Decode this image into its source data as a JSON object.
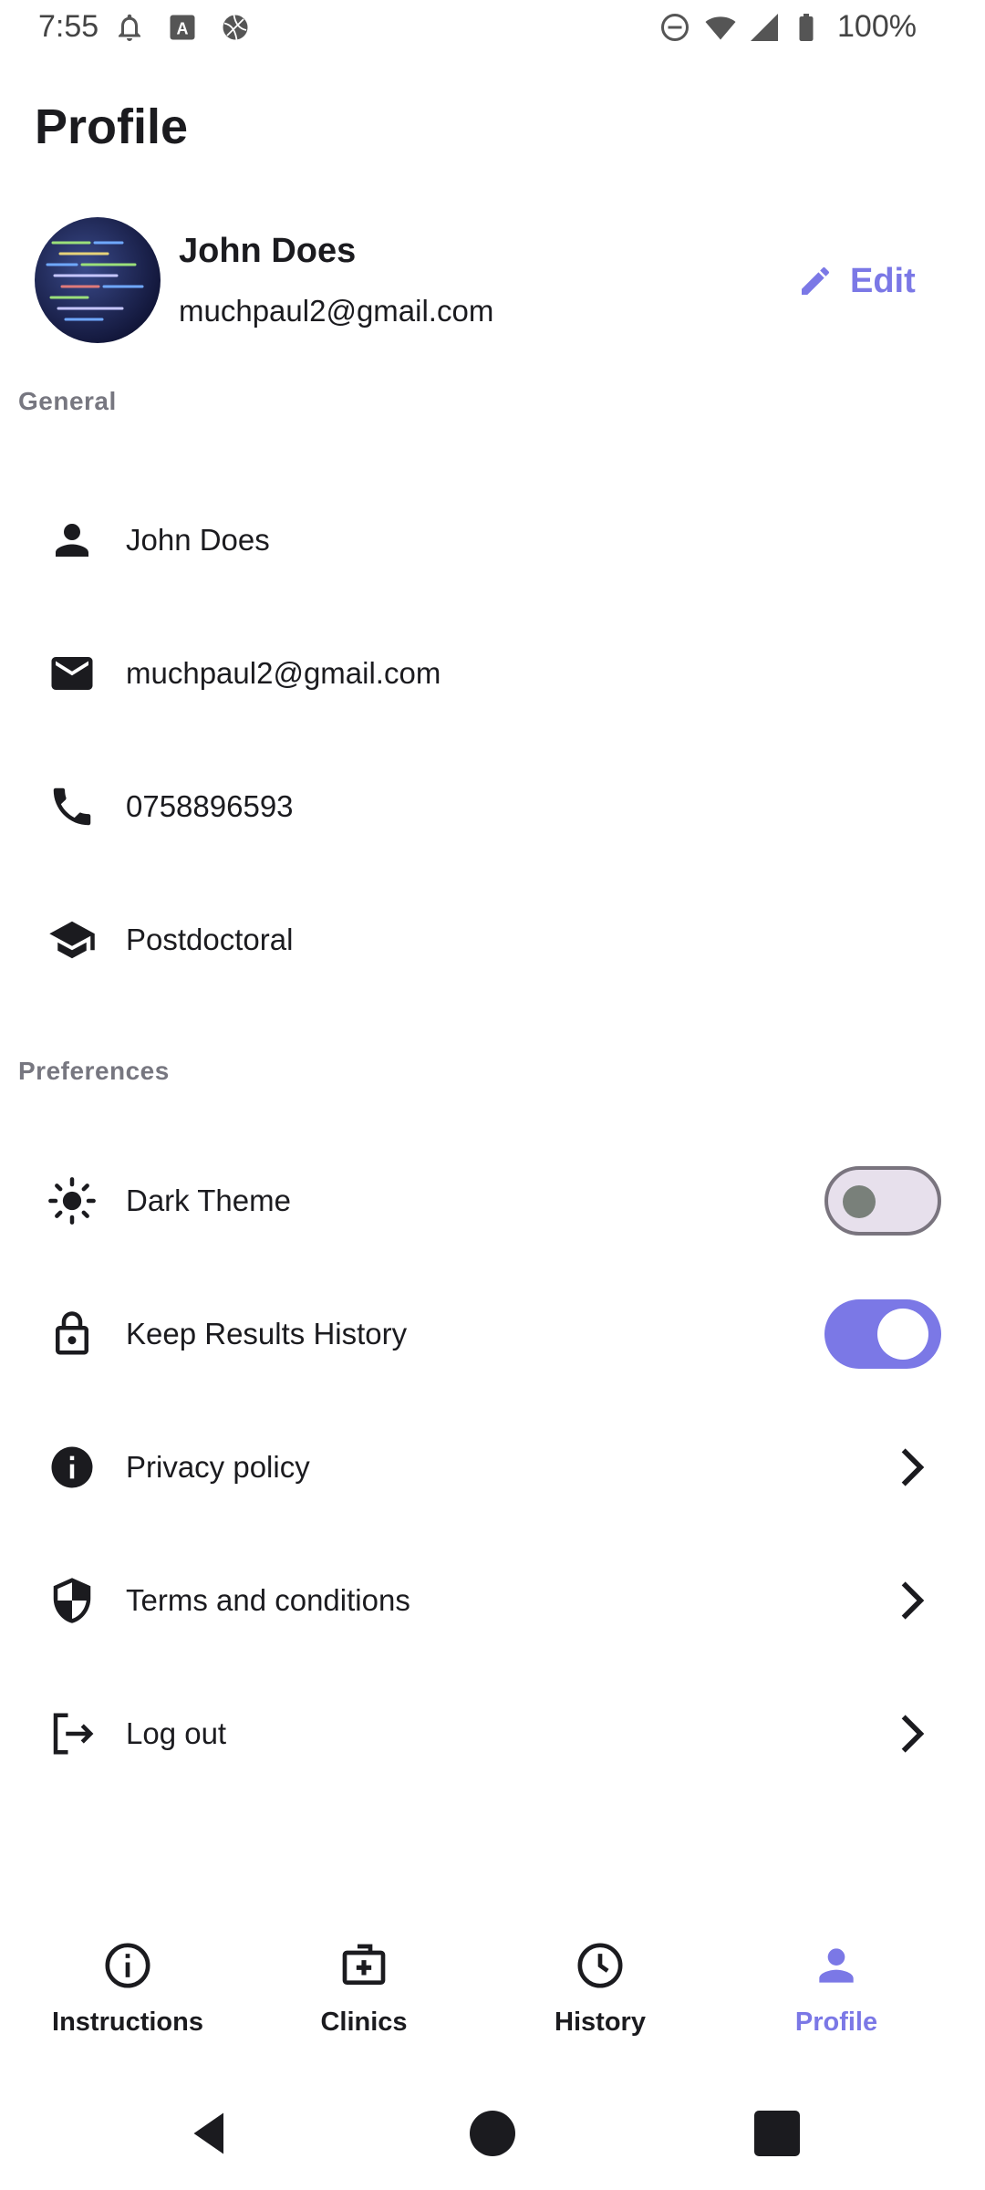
{
  "status_bar": {
    "time": "7:55",
    "battery": "100%",
    "icons": [
      "bell-icon",
      "text-a-icon",
      "basketball-icon",
      "do-not-disturb-icon",
      "wifi-icon",
      "cellular-icon",
      "battery-icon"
    ]
  },
  "header": {
    "title": "Profile"
  },
  "profile": {
    "name": "John Does",
    "email": "muchpaul2@gmail.com",
    "edit_label": "Edit"
  },
  "general": {
    "section_label": "General",
    "items": [
      {
        "icon": "person-icon",
        "label": "John Does"
      },
      {
        "icon": "mail-icon",
        "label": "muchpaul2@gmail.com"
      },
      {
        "icon": "phone-icon",
        "label": "0758896593"
      },
      {
        "icon": "graduation-cap-icon",
        "label": "Postdoctoral"
      }
    ]
  },
  "preferences": {
    "section_label": "Preferences",
    "items": [
      {
        "icon": "sun-icon",
        "label": "Dark Theme",
        "control": "switch",
        "on": false
      },
      {
        "icon": "lock-icon",
        "label": "Keep Results History",
        "control": "switch",
        "on": true
      },
      {
        "icon": "info-icon",
        "label": "Privacy policy",
        "control": "chevron"
      },
      {
        "icon": "shield-icon",
        "label": "Terms and conditions",
        "control": "chevron"
      },
      {
        "icon": "logout-icon",
        "label": "Log out",
        "control": "chevron"
      }
    ]
  },
  "bottom_nav": {
    "items": [
      {
        "icon": "info-outline-icon",
        "label": "Instructions",
        "active": false
      },
      {
        "icon": "medical-kit-icon",
        "label": "Clinics",
        "active": false
      },
      {
        "icon": "clock-icon",
        "label": "History",
        "active": false
      },
      {
        "icon": "person-icon",
        "label": "Profile",
        "active": true
      }
    ]
  },
  "colors": {
    "accent": "#7b78e6",
    "text": "#1b1b1f",
    "muted": "#777780"
  }
}
